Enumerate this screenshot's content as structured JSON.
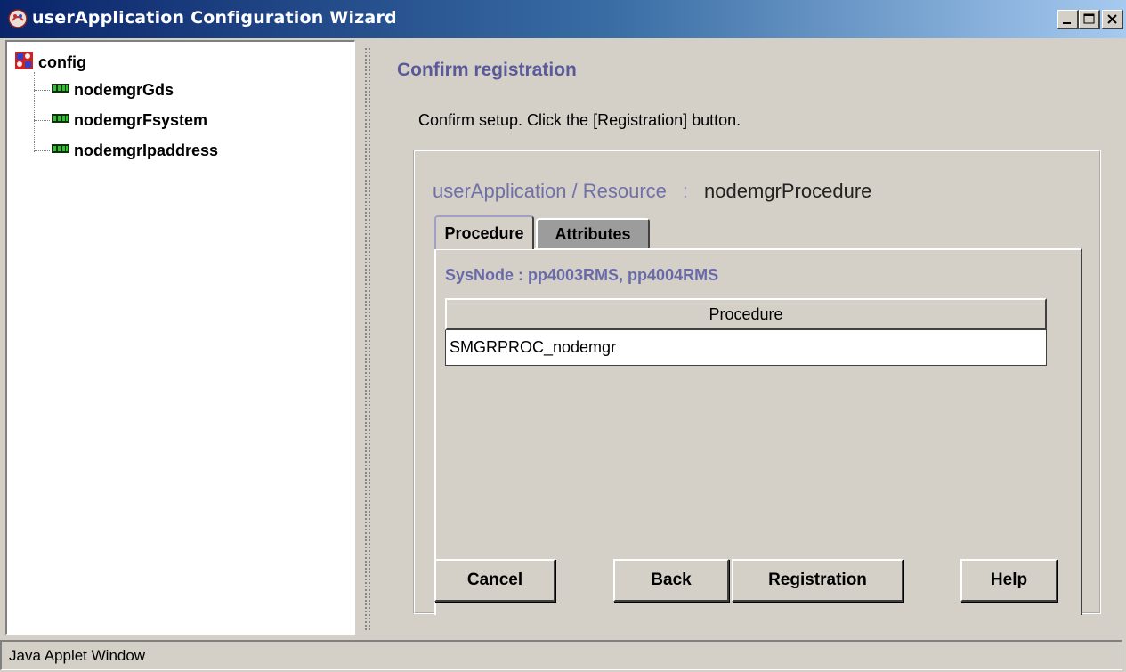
{
  "window": {
    "title": "userApplication Configuration Wizard"
  },
  "tree": {
    "root": {
      "label": "config",
      "icon": "config-icon"
    },
    "items": [
      {
        "label": "nodemgrGds",
        "icon": "resource-icon"
      },
      {
        "label": "nodemgrFsystem",
        "icon": "resource-icon"
      },
      {
        "label": "nodemgrIpaddress",
        "icon": "resource-icon"
      }
    ]
  },
  "main": {
    "heading": "Confirm registration",
    "instruction": "Confirm setup.  Click the [Registration] button.",
    "resource_label": "userApplication / Resource",
    "resource_sep": ":",
    "resource_name": "nodemgrProcedure",
    "tabs": [
      {
        "label": "Procedure",
        "active": true
      },
      {
        "label": "Attributes",
        "active": false
      }
    ],
    "sysnode": "SysNode : pp4003RMS, pp4004RMS",
    "table": {
      "headers": [
        "Procedure"
      ],
      "rows": [
        [
          "SMGRPROC_nodemgr"
        ]
      ]
    }
  },
  "buttons": {
    "cancel": "Cancel",
    "back": "Back",
    "registration": "Registration",
    "help": "Help"
  },
  "statusbar": {
    "text": "Java Applet Window"
  },
  "colors": {
    "title_gradient_start": "#0a246a",
    "title_gradient_end": "#a6caf0",
    "heading": "#5a5a9a",
    "face": "#d4d0c8"
  }
}
